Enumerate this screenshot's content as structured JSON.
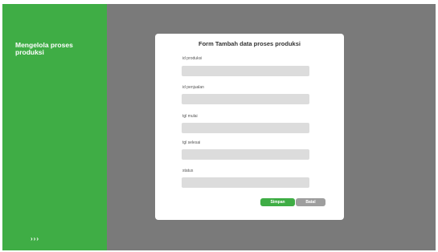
{
  "sidebar": {
    "title": "Mengelola proses produksi",
    "arrows": "›››"
  },
  "form": {
    "title": "Form Tambah data proses produksi",
    "fields": [
      {
        "label": "id produksi",
        "value": ""
      },
      {
        "label": "id penjualan",
        "value": ""
      },
      {
        "label": "tgl mulai",
        "value": ""
      },
      {
        "label": "tgl selesai",
        "value": ""
      },
      {
        "label": "status",
        "value": ""
      }
    ],
    "save_label": "Simpan",
    "cancel_label": "Batal"
  },
  "colors": {
    "accent": "#3fad45",
    "background": "#7a7a7a",
    "input": "#dcdcdc",
    "cancel": "#9e9e9e"
  }
}
